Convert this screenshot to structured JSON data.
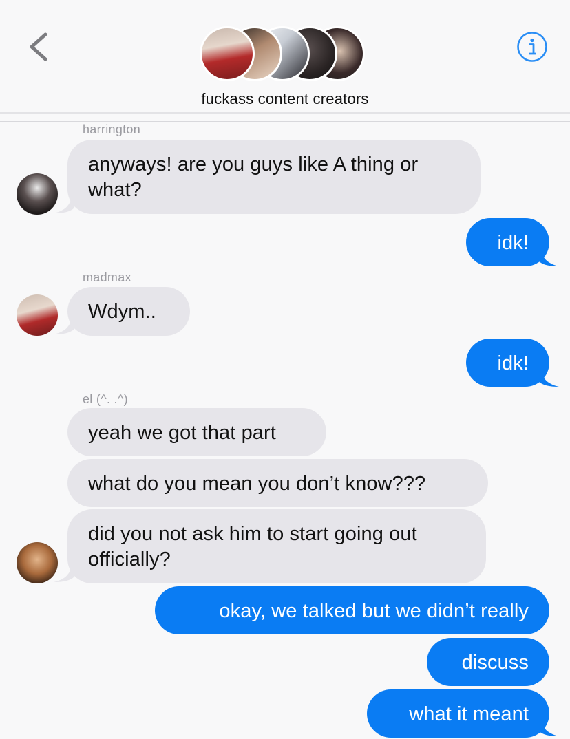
{
  "header": {
    "title": "fuckass content creators",
    "back_icon": "chevron-left-icon",
    "info_icon": "info-icon",
    "accent": "#2a8ef5"
  },
  "messages": [
    {
      "sender": "harrington",
      "lines": [
        "anyways! are you guys like A thing or",
        "what?"
      ]
    },
    {
      "outgoing": "idk!"
    },
    {
      "sender": "madmax",
      "lines": [
        "Wdym.."
      ]
    },
    {
      "outgoing": "idk!"
    },
    {
      "sender": "el (^. .^)",
      "lines": [
        "yeah we got that part"
      ]
    },
    {
      "lines": [
        "what do you mean you don’t know???"
      ]
    },
    {
      "lines": [
        "did you not ask him to start going out",
        "officially?"
      ]
    },
    {
      "outgoing": "okay, we talked but we didn’t really"
    },
    {
      "outgoing": "discuss"
    },
    {
      "outgoing": "what it meant"
    }
  ],
  "colors": {
    "incoming_bubble": "#e6e5ea",
    "outgoing_bubble": "#0a7cf3",
    "sender_label": "#9a9aa0"
  }
}
